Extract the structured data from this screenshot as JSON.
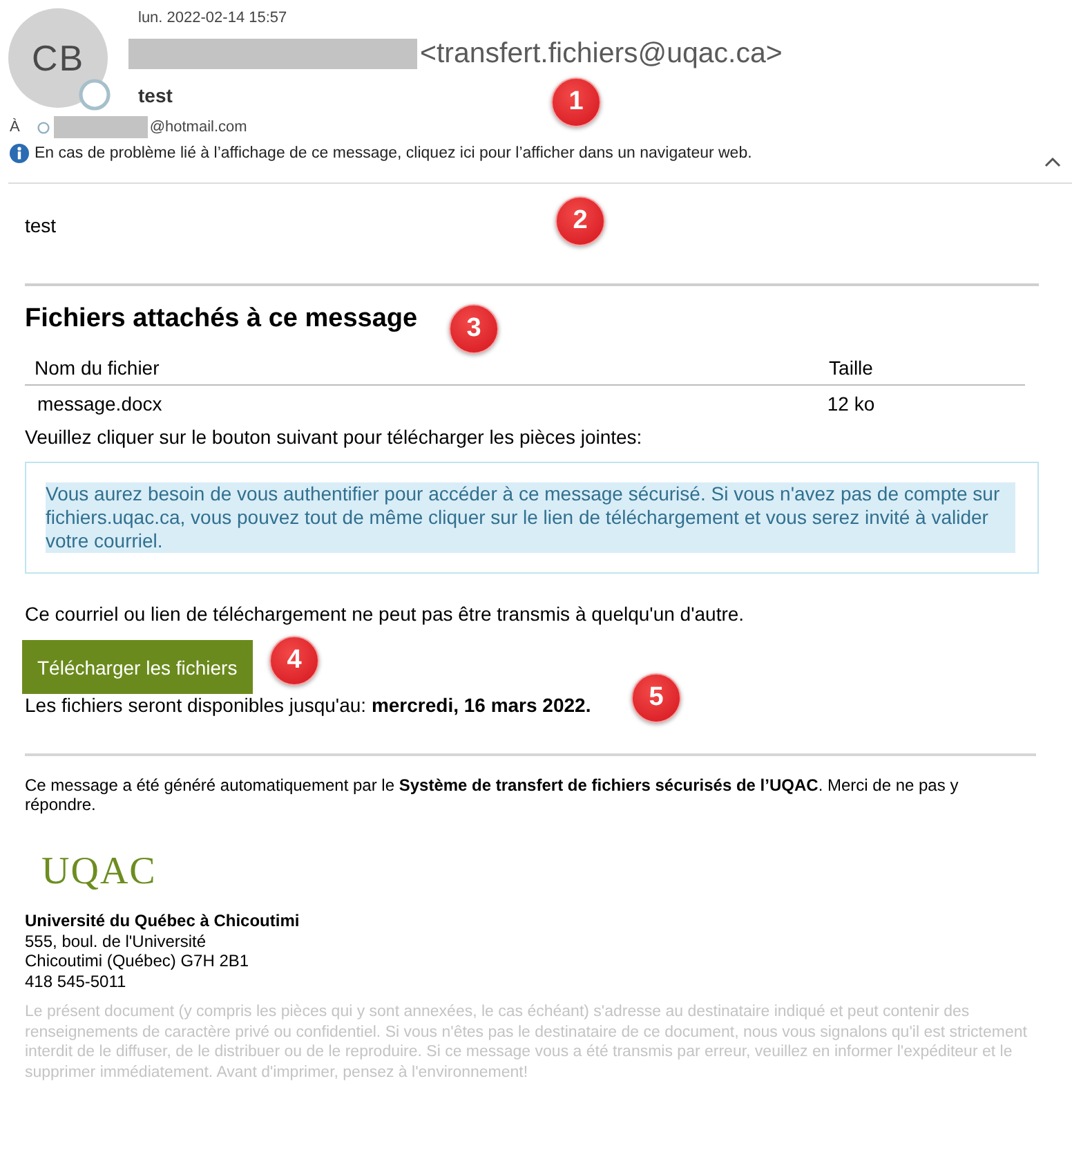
{
  "header": {
    "date": "lun. 2022-02-14 15:57",
    "avatar_initials": "CB",
    "sender_address": "<transfert.fichiers@uqac.ca>",
    "subject": "test",
    "to_label": "À",
    "recipient_domain": "@hotmail.com",
    "info_message": "En cas de problème lié à l’affichage de ce message, cliquez ici pour l’afficher dans un navigateur web.",
    "expanded": true
  },
  "message": {
    "text": "test"
  },
  "attachments": {
    "title": "Fichiers attachés à ce message",
    "columns": [
      "Nom du fichier",
      "Taille"
    ],
    "rows": [
      [
        "message.docx",
        "12 ko"
      ]
    ]
  },
  "instruction": "Veuillez cliquer sur le bouton suivant pour télécharger les pièces jointes:",
  "notice": "Vous aurez besoin de vous authentifier pour accéder à ce message sécurisé. Si vous n'avez pas de compte sur fichiers.uqac.ca, vous pouvez tout de même cliquer sur le lien de téléchargement et vous serez invité à valider votre courriel.",
  "warning": "Ce courriel ou lien de téléchargement ne peut pas être transmis à quelqu'un d'autre.",
  "download_button": "Télécharger les fichiers",
  "availability": "Les fichiers seront disponibles jusqu'au: **mercredi, 16 mars 2022.**",
  "footer": {
    "auto_message": "Ce message a été généré automatiquement par le **Système de transfert de fichiers sécurisés de l’UQAC**. Merci de ne pas y répondre.",
    "logo": "UQAC",
    "organization": "Université du Québec à Chicoutimi",
    "address_lines": [
      "555, boul. de l'Université",
      "Chicoutimi (Québec) G7H 2B1",
      "418 545-5011"
    ],
    "disclaimer": "Le présent document (y compris les pièces qui y sont annexées, le cas échéant) s'adresse au destinataire indiqué et peut contenir des renseignements de caractère privé ou confidentiel. Si vous n'êtes pas le destinataire de ce document, nous vous signalons qu'il est strictement interdit de le diffuser, de le distribuer ou de le reproduire. Si ce message vous a été transmis par erreur, veuillez en informer l'expéditeur et le supprimer immédiatement. Avant d'imprimer, pensez à l'environnement!"
  },
  "callouts": [
    "1",
    "2",
    "3",
    "4",
    "5"
  ]
}
